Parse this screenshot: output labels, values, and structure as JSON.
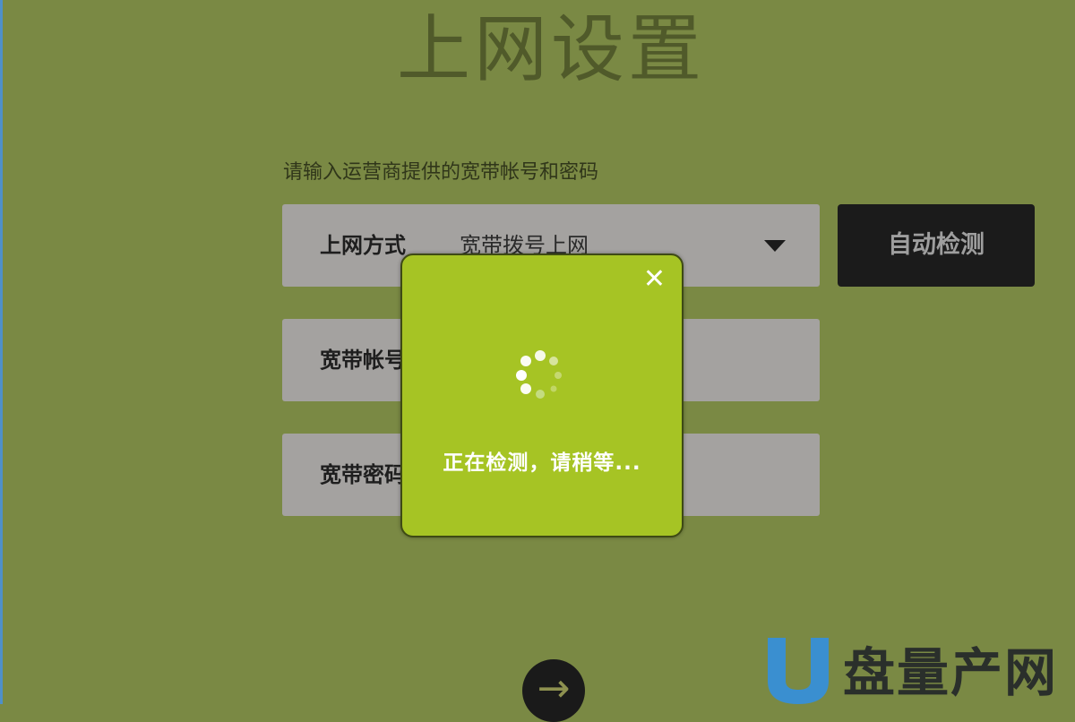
{
  "page": {
    "title": "上网设置",
    "subtitle": "请输入运营商提供的宽带帐号和密码"
  },
  "form": {
    "connection_type": {
      "label": "上网方式",
      "value": "宽带拨号上网"
    },
    "account": {
      "label": "宽带帐号"
    },
    "password": {
      "label": "宽带密码"
    },
    "auto_detect_label": "自动检测",
    "next_icon": "arrow-right-icon"
  },
  "modal": {
    "message": "正在检测，请稍等...",
    "close_icon": "close-icon",
    "spinner_icon": "loading-spinner-icon",
    "close_glyph": "✕"
  },
  "watermark": {
    "text": "盘量产网"
  },
  "colors": {
    "background": "#7a8944",
    "modal_bg": "#a6c424",
    "button_dark": "#1b1b1b",
    "field_bg": "#a4a2a0",
    "watermark_blue": "#3a8fd0"
  }
}
